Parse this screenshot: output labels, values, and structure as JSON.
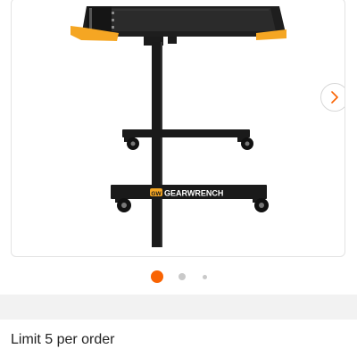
{
  "product": {
    "brand_logo_text": "GEARWRENCH",
    "brand_badge_text": "GW",
    "gallery": {
      "total_images": 3,
      "active_index": 1,
      "next_button": "next-image"
    }
  },
  "colors": {
    "accent": "#f96302",
    "brand_orange": "#f5a623",
    "cart_black": "#1a1a1a"
  },
  "order_limit_text": "Limit 5 per order"
}
